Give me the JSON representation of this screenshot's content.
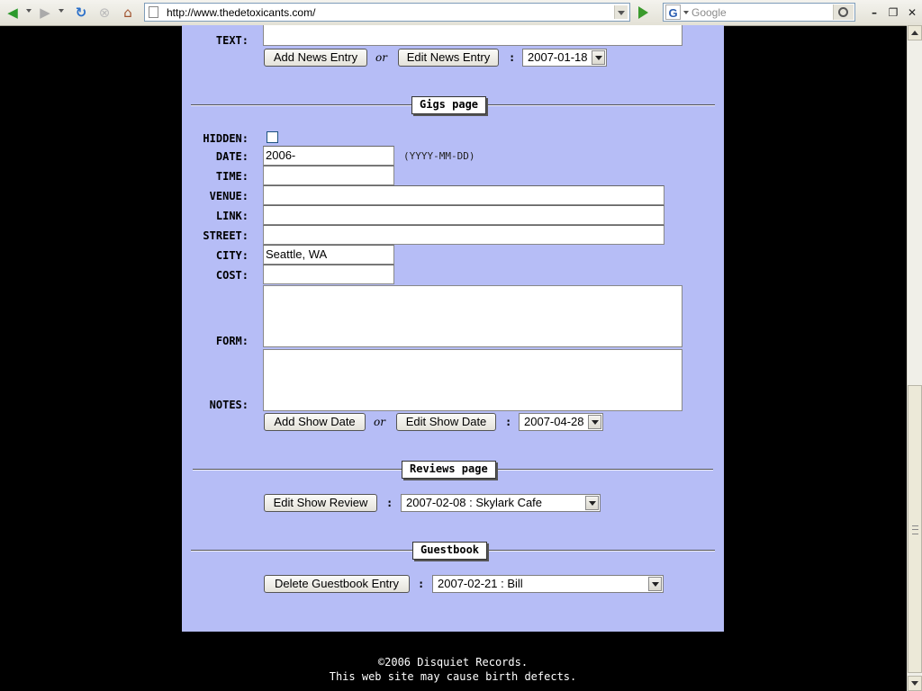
{
  "browser": {
    "url": "http://www.thedetoxicants.com/",
    "search_placeholder": "Google",
    "search_engine_letter": "G"
  },
  "news": {
    "text_label": "TEXT:",
    "add_button": "Add News Entry",
    "or": "or",
    "edit_button": "Edit News Entry",
    "colon": ":",
    "selected_date": "2007-01-18"
  },
  "gigs": {
    "heading": "Gigs page",
    "labels": {
      "hidden": "HIDDEN:",
      "date": "DATE:",
      "time": "TIME:",
      "venue": "VENUE:",
      "link": "LINK:",
      "street": "STREET:",
      "city": "CITY:",
      "cost": "COST:",
      "form": "FORM:",
      "notes": "NOTES:"
    },
    "values": {
      "date": "2006-",
      "time": "",
      "venue": "",
      "link": "",
      "street": "",
      "city": "Seattle, WA",
      "cost": ""
    },
    "date_hint": "(YYYY-MM-DD)",
    "add_button": "Add Show Date",
    "or": "or",
    "edit_button": "Edit Show Date",
    "colon": ":",
    "selected_date": "2007-04-28"
  },
  "reviews": {
    "heading": "Reviews page",
    "edit_button": "Edit Show Review",
    "colon": ":",
    "selected": "2007-02-08 : Skylark Cafe"
  },
  "guestbook": {
    "heading": "Guestbook",
    "delete_button": "Delete Guestbook Entry",
    "colon": ":",
    "selected": "2007-02-21 : Bill"
  },
  "footer": {
    "line1": "©2006 Disquiet Records.",
    "line2": "This web site may cause birth defects."
  },
  "colors": {
    "panel_bg": "#b6bdf6",
    "page_bg": "#000000"
  }
}
